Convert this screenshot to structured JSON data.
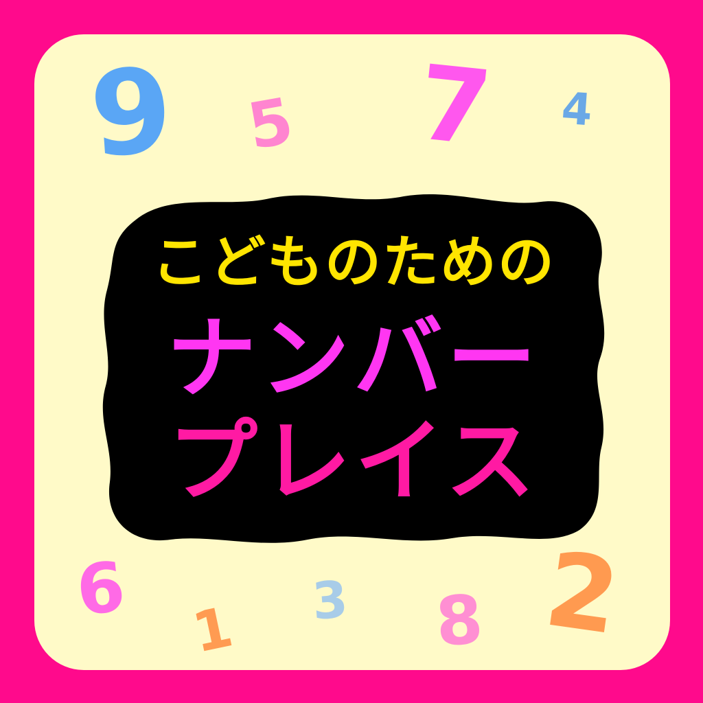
{
  "title": {
    "subtitle": "こどものための",
    "line1": "ナンバー",
    "line2": "プレイス"
  },
  "digits": [
    {
      "key": "n9",
      "text": "9"
    },
    {
      "key": "n5",
      "text": "5"
    },
    {
      "key": "n7",
      "text": "7"
    },
    {
      "key": "n4",
      "text": "4"
    },
    {
      "key": "n6",
      "text": "6"
    },
    {
      "key": "n1",
      "text": "1"
    },
    {
      "key": "n3",
      "text": "3"
    },
    {
      "key": "n8",
      "text": "8"
    },
    {
      "key": "n2",
      "text": "2"
    }
  ],
  "colors": {
    "frame": "#ff0a8c",
    "background": "#fffac8",
    "blob": "#000000",
    "subtitle": "#ffe500",
    "line1": "#ff36f2",
    "line2": "#ff1aa3",
    "digit9": "#5aa6f5",
    "digit5": "#ff85d0",
    "digit7": "#ff57ee",
    "digit4": "#6aa8e6",
    "digit6": "#ff6ae6",
    "digit1": "#ff9b52",
    "digit3": "#a8cce8",
    "digit8": "#ff8fd3",
    "digit2": "#ff9a50"
  }
}
